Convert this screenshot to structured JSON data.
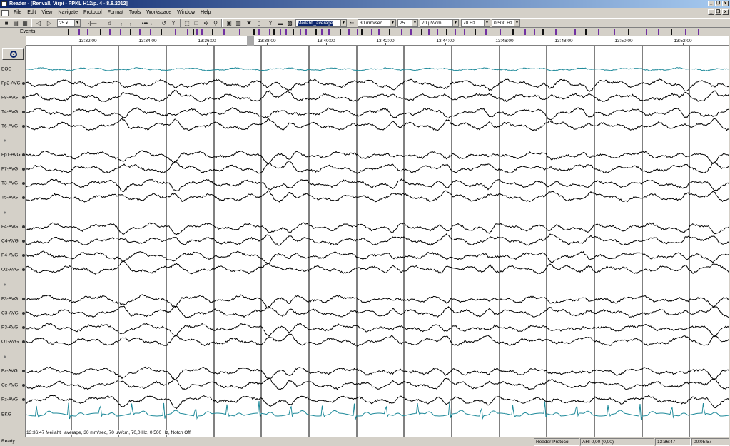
{
  "window": {
    "title": "Reader - [Renvall, Virpi - PPKL H12/p. 4 - 8.8.2012]",
    "minimize": "_",
    "restore": "❐",
    "close": "x"
  },
  "menu": [
    "File",
    "Edit",
    "View",
    "Navigate",
    "Protocol",
    "Format",
    "Tools",
    "Workspace",
    "Window",
    "Help"
  ],
  "toolbar": {
    "zoom_value": "25 x",
    "montage_value": "Meilahti_average",
    "speed_value": "30 mm/sec",
    "channels_value": "25",
    "sensitivity_value": "70 µV/cm",
    "highpass_value": "70 Hz",
    "lowpass_value": "0,500 Hz"
  },
  "events": {
    "label": "Events",
    "accent_color": "#7030a0"
  },
  "timeline": {
    "labels": [
      "13:32:00",
      "13:34:00",
      "13:36:00",
      "13:38:00",
      "13:40:00",
      "13:42:00",
      "13:44:00",
      "13:46:00",
      "13:48:00",
      "13:50:00",
      "13:52:00"
    ]
  },
  "channels": [
    {
      "label": "EOG",
      "dot": false,
      "color": "#1e8a9a"
    },
    {
      "label": "Fp2-AVG",
      "dot": true,
      "color": "#000000"
    },
    {
      "label": "F8-AVG",
      "dot": true,
      "color": "#000000"
    },
    {
      "label": "T4-AVG",
      "dot": true,
      "color": "#000000"
    },
    {
      "label": "T6-AVG",
      "dot": true,
      "color": "#000000"
    },
    {
      "label": "Fp1-AVG",
      "dot": true,
      "color": "#000000"
    },
    {
      "label": "F7-AVG",
      "dot": true,
      "color": "#000000"
    },
    {
      "label": "T3-AVG",
      "dot": true,
      "color": "#000000"
    },
    {
      "label": "T5-AVG",
      "dot": true,
      "color": "#000000"
    },
    {
      "label": "F4-AVG",
      "dot": true,
      "color": "#000000"
    },
    {
      "label": "C4-AVG",
      "dot": true,
      "color": "#000000"
    },
    {
      "label": "P4-AVG",
      "dot": true,
      "color": "#000000"
    },
    {
      "label": "O2-AVG",
      "dot": true,
      "color": "#000000"
    },
    {
      "label": "F3-AVG",
      "dot": true,
      "color": "#000000"
    },
    {
      "label": "C3-AVG",
      "dot": true,
      "color": "#000000"
    },
    {
      "label": "P3-AVG",
      "dot": true,
      "color": "#000000"
    },
    {
      "label": "O1-AVG",
      "dot": true,
      "color": "#000000"
    },
    {
      "label": "Fz-AVG",
      "dot": true,
      "color": "#000000"
    },
    {
      "label": "Cz-AVG",
      "dot": true,
      "color": "#000000"
    },
    {
      "label": "Pz-AVG",
      "dot": true,
      "color": "#000000"
    },
    {
      "label": "EKG",
      "dot": false,
      "color": "#1e8a9a"
    }
  ],
  "info_overlay": "13:36:47 Meilahti_average, 30 mm/sec, 70 µV/cm, 70,0 Hz, 0,500 Hz, Notch Off",
  "status": {
    "ready": "Ready",
    "protocol": "Reader Protocol",
    "ahi": "AHI 0,00 (0,00)",
    "time": "13:36:47",
    "duration": "00:05:57"
  }
}
